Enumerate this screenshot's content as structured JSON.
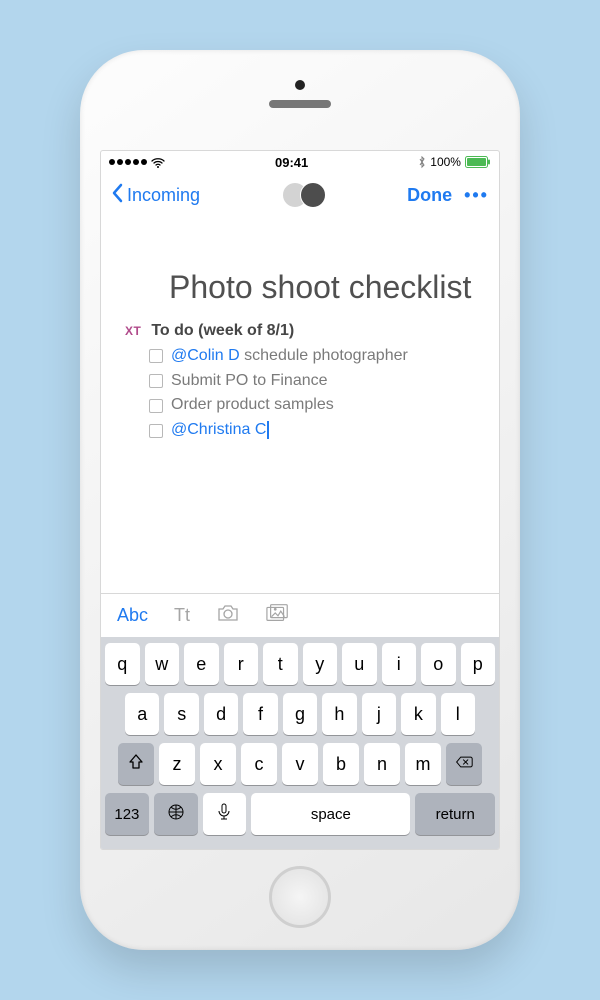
{
  "statusbar": {
    "time": "09:41",
    "battery_pct": "100%",
    "bluetooth_icon": "bluetooth",
    "signal_icon": "signal-dots",
    "wifi_icon": "wifi"
  },
  "navbar": {
    "back_label": "Incoming",
    "done_label": "Done",
    "more_label": "•••"
  },
  "note": {
    "title": "Photo shoot checklist",
    "heading_prefix": "XT",
    "heading": "To do (week of 8/1)",
    "tasks": [
      {
        "mention": "@Colin D",
        "text": " schedule photographer"
      },
      {
        "mention": "",
        "text": "Submit PO to Finance"
      },
      {
        "mention": "",
        "text": "Order product samples"
      },
      {
        "mention": "@Christina C",
        "text": ""
      }
    ]
  },
  "formatbar": {
    "abc": "Abc",
    "tt": "Tt",
    "camera_icon": "camera",
    "gallery_icon": "gallery"
  },
  "keyboard": {
    "row1": [
      "q",
      "w",
      "e",
      "r",
      "t",
      "y",
      "u",
      "i",
      "o",
      "p"
    ],
    "row2": [
      "a",
      "s",
      "d",
      "f",
      "g",
      "h",
      "j",
      "k",
      "l"
    ],
    "row3": [
      "z",
      "x",
      "c",
      "v",
      "b",
      "n",
      "m"
    ],
    "shift_icon": "shift",
    "backspace_icon": "backspace",
    "numbers": "123",
    "globe_icon": "globe",
    "mic_icon": "mic",
    "space": "space",
    "return": "return"
  }
}
